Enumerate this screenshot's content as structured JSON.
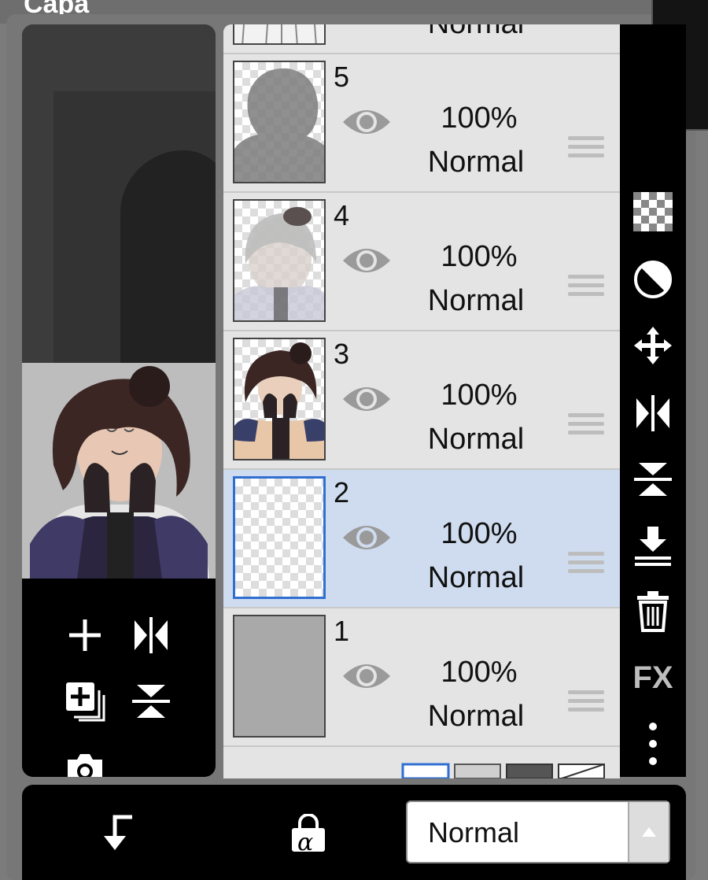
{
  "window": {
    "title": "Capa"
  },
  "layers": [
    {
      "number": "5",
      "opacity": "100%",
      "blend": "Normal",
      "selected": false,
      "thumb": "gray-figure-checker"
    },
    {
      "number": "4",
      "opacity": "100%",
      "blend": "Normal",
      "selected": false,
      "thumb": "faded-character"
    },
    {
      "number": "3",
      "opacity": "100%",
      "blend": "Normal",
      "selected": false,
      "thumb": "character-color"
    },
    {
      "number": "2",
      "opacity": "100%",
      "blend": "Normal",
      "selected": true,
      "thumb": "transparent"
    },
    {
      "number": "1",
      "opacity": "100%",
      "blend": "Normal",
      "selected": false,
      "thumb": "solid-gray"
    }
  ],
  "partial_top_layer": {
    "blend": "Normal"
  },
  "right_toolbar": {
    "items": [
      "transparency-checker-icon",
      "opacity-circle-icon",
      "move-icon",
      "flip-horizontal-icon",
      "flip-vertical-icon",
      "merge-down-icon",
      "trash-icon",
      "fx-icon",
      "more-vertical-icon"
    ],
    "fx_label": "FX"
  },
  "left_tools": [
    "add-layer-icon",
    "flip-horizontal-icon",
    "duplicate-layer-icon",
    "flip-vertical-icon",
    "camera-icon"
  ],
  "bottom_bar": {
    "blend_mode_value": "Normal",
    "clipping_label": "α"
  },
  "colors": {
    "selected_row": "#cfdcef",
    "selected_border": "#2f6fd1",
    "toolbar_bg": "#000000"
  }
}
